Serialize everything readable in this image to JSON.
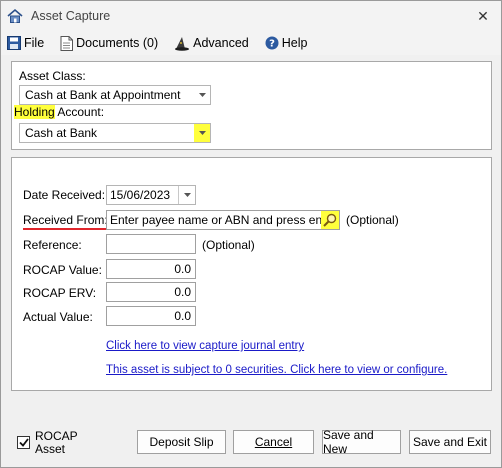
{
  "window": {
    "title": "Asset Capture",
    "close_glyph": "✕"
  },
  "menu": {
    "file": "File",
    "documents": "Documents (0)",
    "advanced": "Advanced",
    "help": "Help"
  },
  "top_panel": {
    "asset_class_label": "Asset Class:",
    "asset_class_value": "Cash at Bank at Appointment",
    "holding_label_part1": "Holding",
    "holding_label_part2": " Account:",
    "holding_value": "Cash at Bank"
  },
  "form": {
    "date_label": "Date Received:",
    "date_value": "15/06/2023",
    "received_from_label": "Received From:",
    "received_from_placeholder": "Enter payee name or ABN and press enter",
    "optional_1": "(Optional)",
    "reference_label": "Reference:",
    "reference_value": "",
    "optional_2": "(Optional)",
    "rocap_value_label": "ROCAP Value:",
    "rocap_value": "0.0",
    "rocap_erv_label": "ROCAP ERV:",
    "rocap_erv": "0.0",
    "actual_value_label": "Actual Value:",
    "actual_value": "0.0",
    "journal_link": "Click here to view capture journal entry",
    "securities_link": "This asset is subject to 0 securities.  Click here to view or configure."
  },
  "footer": {
    "rocap_checkbox_label_1": "ROCAP",
    "rocap_checkbox_label_2": "Asset",
    "rocap_checked": true,
    "deposit_slip": "Deposit Slip",
    "cancel": "Cancel",
    "save_new": "Save and New",
    "save_exit": "Save and Exit"
  },
  "colors": {
    "highlight": "#ffff3c",
    "annotation_red": "#e0262c",
    "link_blue": "#1a1ac8"
  }
}
